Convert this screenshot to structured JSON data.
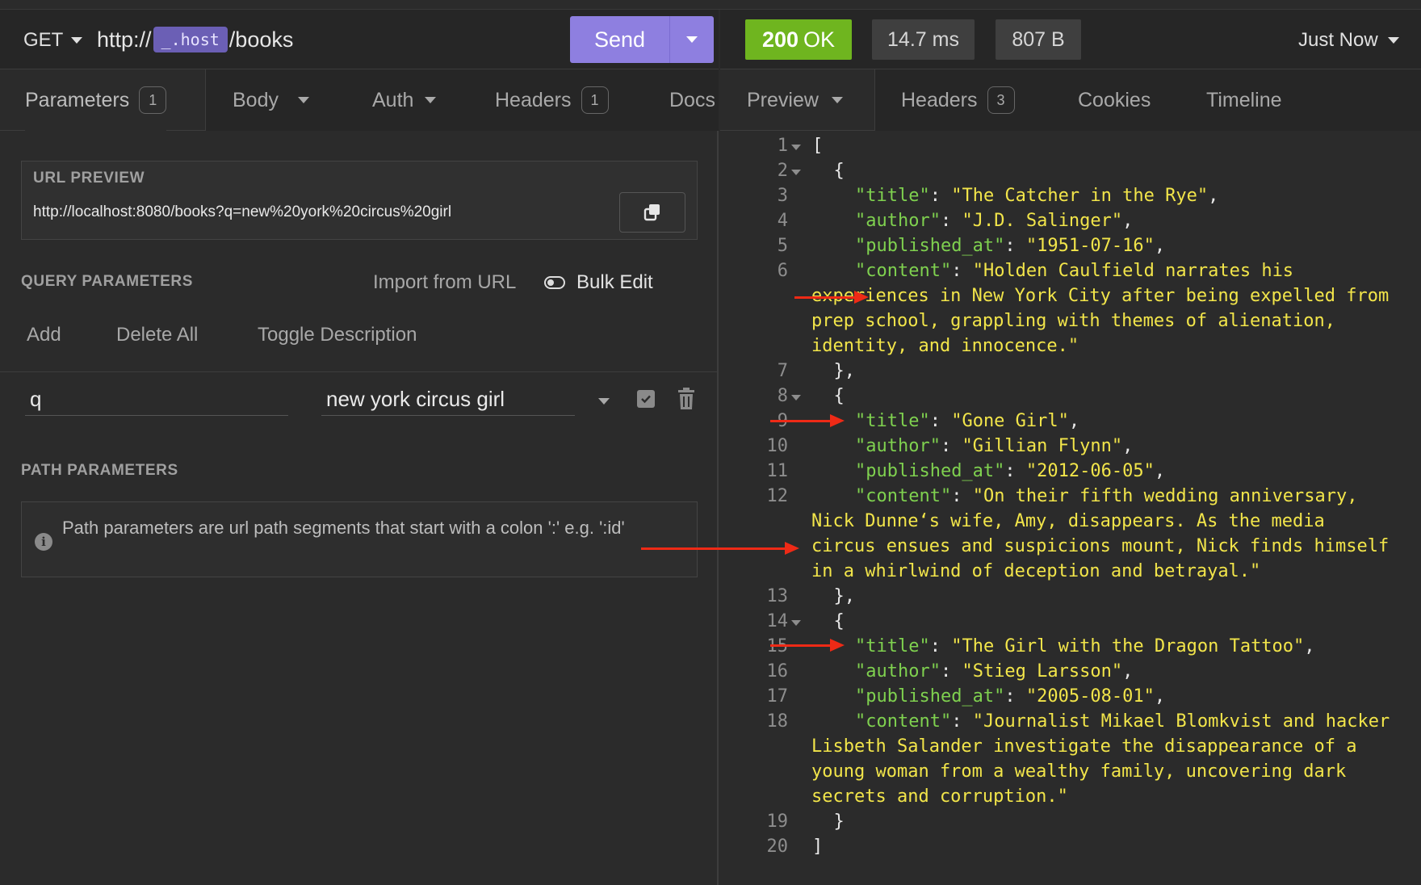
{
  "request": {
    "method": "GET",
    "url_prefix": "http://",
    "url_host_chip": "_.host",
    "url_suffix": "/books",
    "send_label": "Send"
  },
  "request_tabs": [
    {
      "label": "Parameters",
      "count": "1"
    },
    {
      "label": "Body"
    },
    {
      "label": "Auth"
    },
    {
      "label": "Headers",
      "count": "1"
    },
    {
      "label": "Docs"
    }
  ],
  "url_preview": {
    "label": "URL PREVIEW",
    "value": "http://localhost:8080/books?q=new%20york%20circus%20girl"
  },
  "query_params": {
    "label": "QUERY PARAMETERS",
    "import_label": "Import from URL",
    "bulk_edit_label": "Bulk Edit",
    "actions": [
      "Add",
      "Delete All",
      "Toggle Description"
    ],
    "rows": [
      {
        "name": "q",
        "value": "new york circus girl"
      }
    ]
  },
  "path_params": {
    "label": "PATH PARAMETERS",
    "info": "Path parameters are url path segments that start with a colon ':' e.g. ':id'"
  },
  "response": {
    "status_code": "200",
    "status_text": "OK",
    "time": "14.7 ms",
    "size": "807 B",
    "when": "Just Now",
    "status_color": "#6fb51f"
  },
  "response_tabs": [
    {
      "label": "Preview"
    },
    {
      "label": "Headers",
      "count": "3"
    },
    {
      "label": "Cookies"
    },
    {
      "label": "Timeline"
    }
  ],
  "code_lines": [
    {
      "n": "1",
      "fold": true,
      "text": "["
    },
    {
      "n": "2",
      "fold": true,
      "text": "  {"
    },
    {
      "n": "3",
      "key": "title",
      "value": "The Catcher in the Rye",
      "comma": true
    },
    {
      "n": "4",
      "key": "author",
      "value": "J.D. Salinger",
      "comma": true
    },
    {
      "n": "5",
      "key": "published_at",
      "value": "1951-07-16",
      "comma": true
    },
    {
      "n": "6",
      "key": "content",
      "value_lines": [
        "\"Holden Caulfield narrates his",
        "experiences in New York City after being expelled from",
        "prep school, grappling with themes of alienation,",
        "identity, and innocence.\""
      ]
    },
    {
      "n": "7",
      "text": "  },"
    },
    {
      "n": "8",
      "fold": true,
      "text": "  {"
    },
    {
      "n": "9",
      "key": "title",
      "value": "Gone Girl",
      "comma": true
    },
    {
      "n": "10",
      "key": "author",
      "value": "Gillian Flynn",
      "comma": true
    },
    {
      "n": "11",
      "key": "published_at",
      "value": "2012-06-05",
      "comma": true
    },
    {
      "n": "12",
      "key": "content",
      "value_lines": [
        "\"On their fifth wedding anniversary,",
        "Nick Dunne‘s wife, Amy, disappears. As the media",
        "circus ensues and suspicions mount, Nick finds himself",
        "in a whirlwind of deception and betrayal.\""
      ]
    },
    {
      "n": "13",
      "text": "  },"
    },
    {
      "n": "14",
      "fold": true,
      "text": "  {"
    },
    {
      "n": "15",
      "key": "title",
      "value": "The Girl with the Dragon Tattoo",
      "comma": true
    },
    {
      "n": "16",
      "key": "author",
      "value": "Stieg Larsson",
      "comma": true
    },
    {
      "n": "17",
      "key": "published_at",
      "value": "2005-08-01",
      "comma": true
    },
    {
      "n": "18",
      "key": "content",
      "value_lines": [
        "\"Journalist Mikael Blomkvist and hacker",
        "Lisbeth Salander investigate the disappearance of a",
        "young woman from a wealthy family, uncovering dark",
        "secrets and corruption.\""
      ]
    },
    {
      "n": "19",
      "text": "  }"
    },
    {
      "n": "20",
      "text": "]"
    }
  ],
  "annotation_color": "#ee2a16"
}
